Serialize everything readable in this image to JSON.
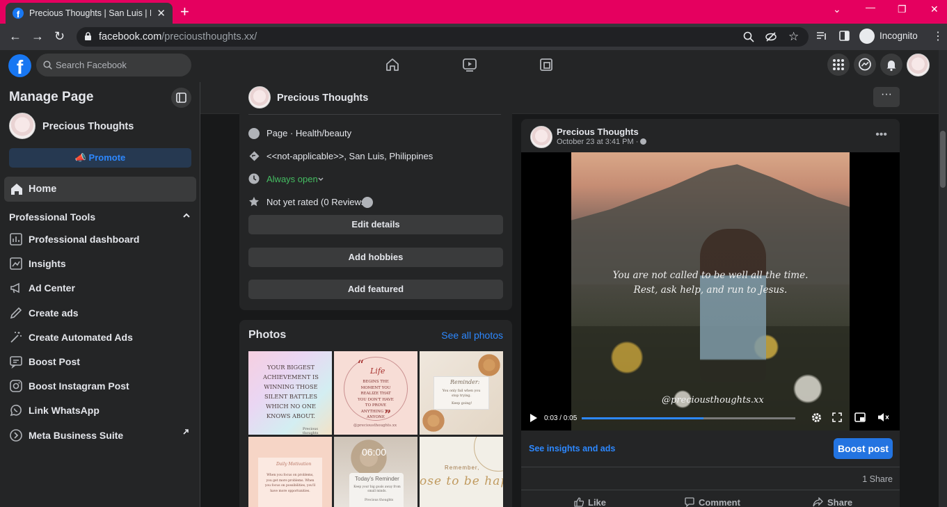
{
  "browser": {
    "tab_title": "Precious Thoughts | San Luis | Fac",
    "url_domain": "facebook.com",
    "url_path": "/precious­thoughts.xx/",
    "incognito_label": "Incognito"
  },
  "fbnav": {
    "search_placeholder": "Search Facebook"
  },
  "sidebar": {
    "title": "Manage Page",
    "page_name": "Precious Thoughts",
    "promote_label": "Promote",
    "home_label": "Home",
    "tools_heading": "Professional Tools",
    "items": [
      {
        "label": "Professional dashboard",
        "icon": "dashboard-icon"
      },
      {
        "label": "Insights",
        "icon": "insights-icon"
      },
      {
        "label": "Ad Center",
        "icon": "megaphone-icon"
      },
      {
        "label": "Create ads",
        "icon": "pencil-icon"
      },
      {
        "label": "Create Automated Ads",
        "icon": "magic-wand-icon"
      },
      {
        "label": "Boost Post",
        "icon": "boost-post-icon"
      },
      {
        "label": "Boost Instagram Post",
        "icon": "instagram-icon"
      },
      {
        "label": "Link WhatsApp",
        "icon": "whatsapp-icon"
      },
      {
        "label": "Meta Business Suite",
        "icon": "meta-business-icon"
      }
    ]
  },
  "pagebar": {
    "name": "Precious Thoughts"
  },
  "intro": {
    "category": "Page · Health/beauty",
    "location": "<<not-applicable>>, San Luis, Philippines",
    "hours": "Always open",
    "rating": "Not yet rated (0 Reviews)",
    "buttons": [
      "Edit details",
      "Add hobbies",
      "Add featured"
    ]
  },
  "photos": {
    "title": "Photos",
    "see_all": "See all photos",
    "thumb1_text": "YOUR BIGGEST ACHIEVEMENT IS WINNING THOSE SILENT BATTLES WHICH NO ONE KNOWS ABOUT.",
    "thumb1_footer": "Precious thoughts",
    "thumb2_title": "Life",
    "thumb2_text": "BEGINS THE MOMENT YOU REALIZE THAT YOU DON'T HAVE TO PROVE ANYTHING TO ANYONE",
    "thumb2_footer": "@precious­thoughts.xx",
    "thumb3_title": "Reminder:",
    "thumb3_text": "You only fail when you stop trying.",
    "thumb3_footer": "Keep going!",
    "thumb4_title": "Daily Motivation",
    "thumb4_text": "When you focus on problems, you get more problems. When you focus on possibilities, you'll have more opportunities.",
    "thumb5_time": "06:00",
    "thumb5_title": "Today's Reminder",
    "thumb5_text": "Keep your big goals away from small minds.",
    "thumb5_footer": "Precious thoughts",
    "thumb6_title": "Remember,",
    "thumb6_text": "ose to be hap"
  },
  "post": {
    "author": "Precious Thoughts",
    "time": "October 23 at 3:41 PM ·",
    "quote": "You are not called to be well all the time. Rest, ask help, and run to Jesus.",
    "handle": "@precious­thoughts.xx",
    "video_time": "0:03 / 0:05",
    "progress": 0.57,
    "insights_link": "See insights and ads",
    "boost_label": "Boost post",
    "share_count": "1 Share",
    "like_label": "Like",
    "comment_label": "Comment",
    "share_label": "Share"
  },
  "colors": {
    "tabbar": "#e5005f",
    "fb_blue": "#1877f2",
    "link_blue": "#2d88ff",
    "open_green": "#45bd62"
  }
}
